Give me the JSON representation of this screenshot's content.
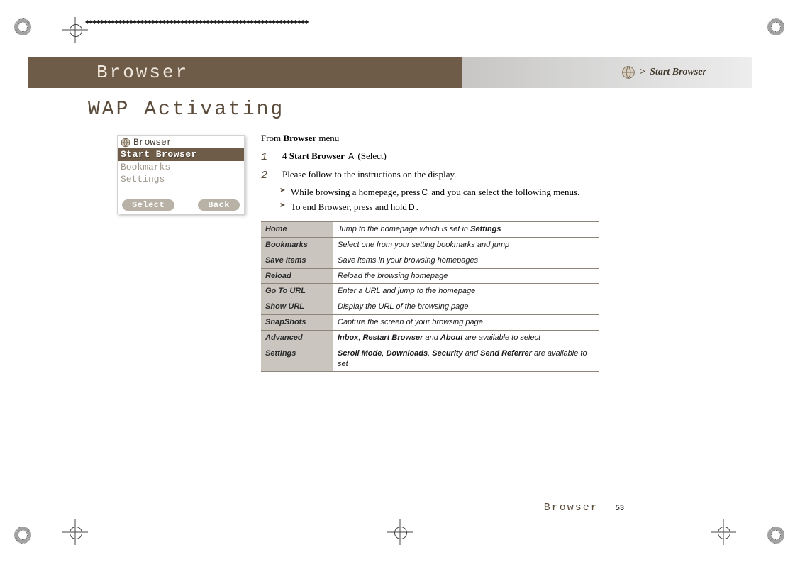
{
  "header": {
    "title": "Browser",
    "breadcrumb_prefix": ">",
    "breadcrumb_text": "Start Browser"
  },
  "section_heading": "WAP Activating",
  "phone": {
    "title": "Browser",
    "items": [
      "Start Browser",
      "Bookmarks",
      "Settings"
    ],
    "softkeys": {
      "left": "Select",
      "right": "Back"
    }
  },
  "body": {
    "from_prefix": "From ",
    "from_menu": "Browser",
    "from_suffix": " menu",
    "steps": [
      {
        "n": "1",
        "pre": "4 ",
        "bold": "Start Browser",
        "key": "A",
        "paren": "Select"
      },
      {
        "n": "2",
        "text": "Please follow to the instructions on the display."
      }
    ],
    "notes": [
      {
        "pre": "While browsing a homepage, press",
        "key": "C",
        "post": " and you can select the following menus."
      },
      {
        "pre": "To end Browser, press and hold",
        "key": "D",
        "post": "."
      }
    ]
  },
  "option_rows": [
    {
      "k": "Home",
      "v_parts": [
        "Jump to the homepage which is set in ",
        {
          "b": "Settings"
        }
      ]
    },
    {
      "k": "Bookmarks",
      "v_parts": [
        "Select one from your setting bookmarks and jump"
      ]
    },
    {
      "k": "Save Items",
      "v_parts": [
        "Save items in your browsing homepages"
      ]
    },
    {
      "k": "Reload",
      "v_parts": [
        "Reload the browsing homepage"
      ]
    },
    {
      "k": "Go To URL",
      "v_parts": [
        "Enter a URL and jump to the homepage"
      ]
    },
    {
      "k": "Show URL",
      "v_parts": [
        "Display the URL of the browsing page"
      ]
    },
    {
      "k": "SnapShots",
      "v_parts": [
        "Capture the screen of your browsing page"
      ]
    },
    {
      "k": "Advanced",
      "v_parts": [
        {
          "b": "Inbox"
        },
        ", ",
        {
          "b": "Restart Browser"
        },
        " and ",
        {
          "b": "About"
        },
        " are available to select"
      ]
    },
    {
      "k": "Settings",
      "v_parts": [
        {
          "b": "Scroll Mode"
        },
        ", ",
        {
          "b": "Downloads"
        },
        ", ",
        {
          "b": "Security"
        },
        " and ",
        {
          "b": "Send Referrer"
        },
        " are available to set"
      ]
    }
  ],
  "footer": {
    "section": "Browser",
    "page": "53"
  }
}
